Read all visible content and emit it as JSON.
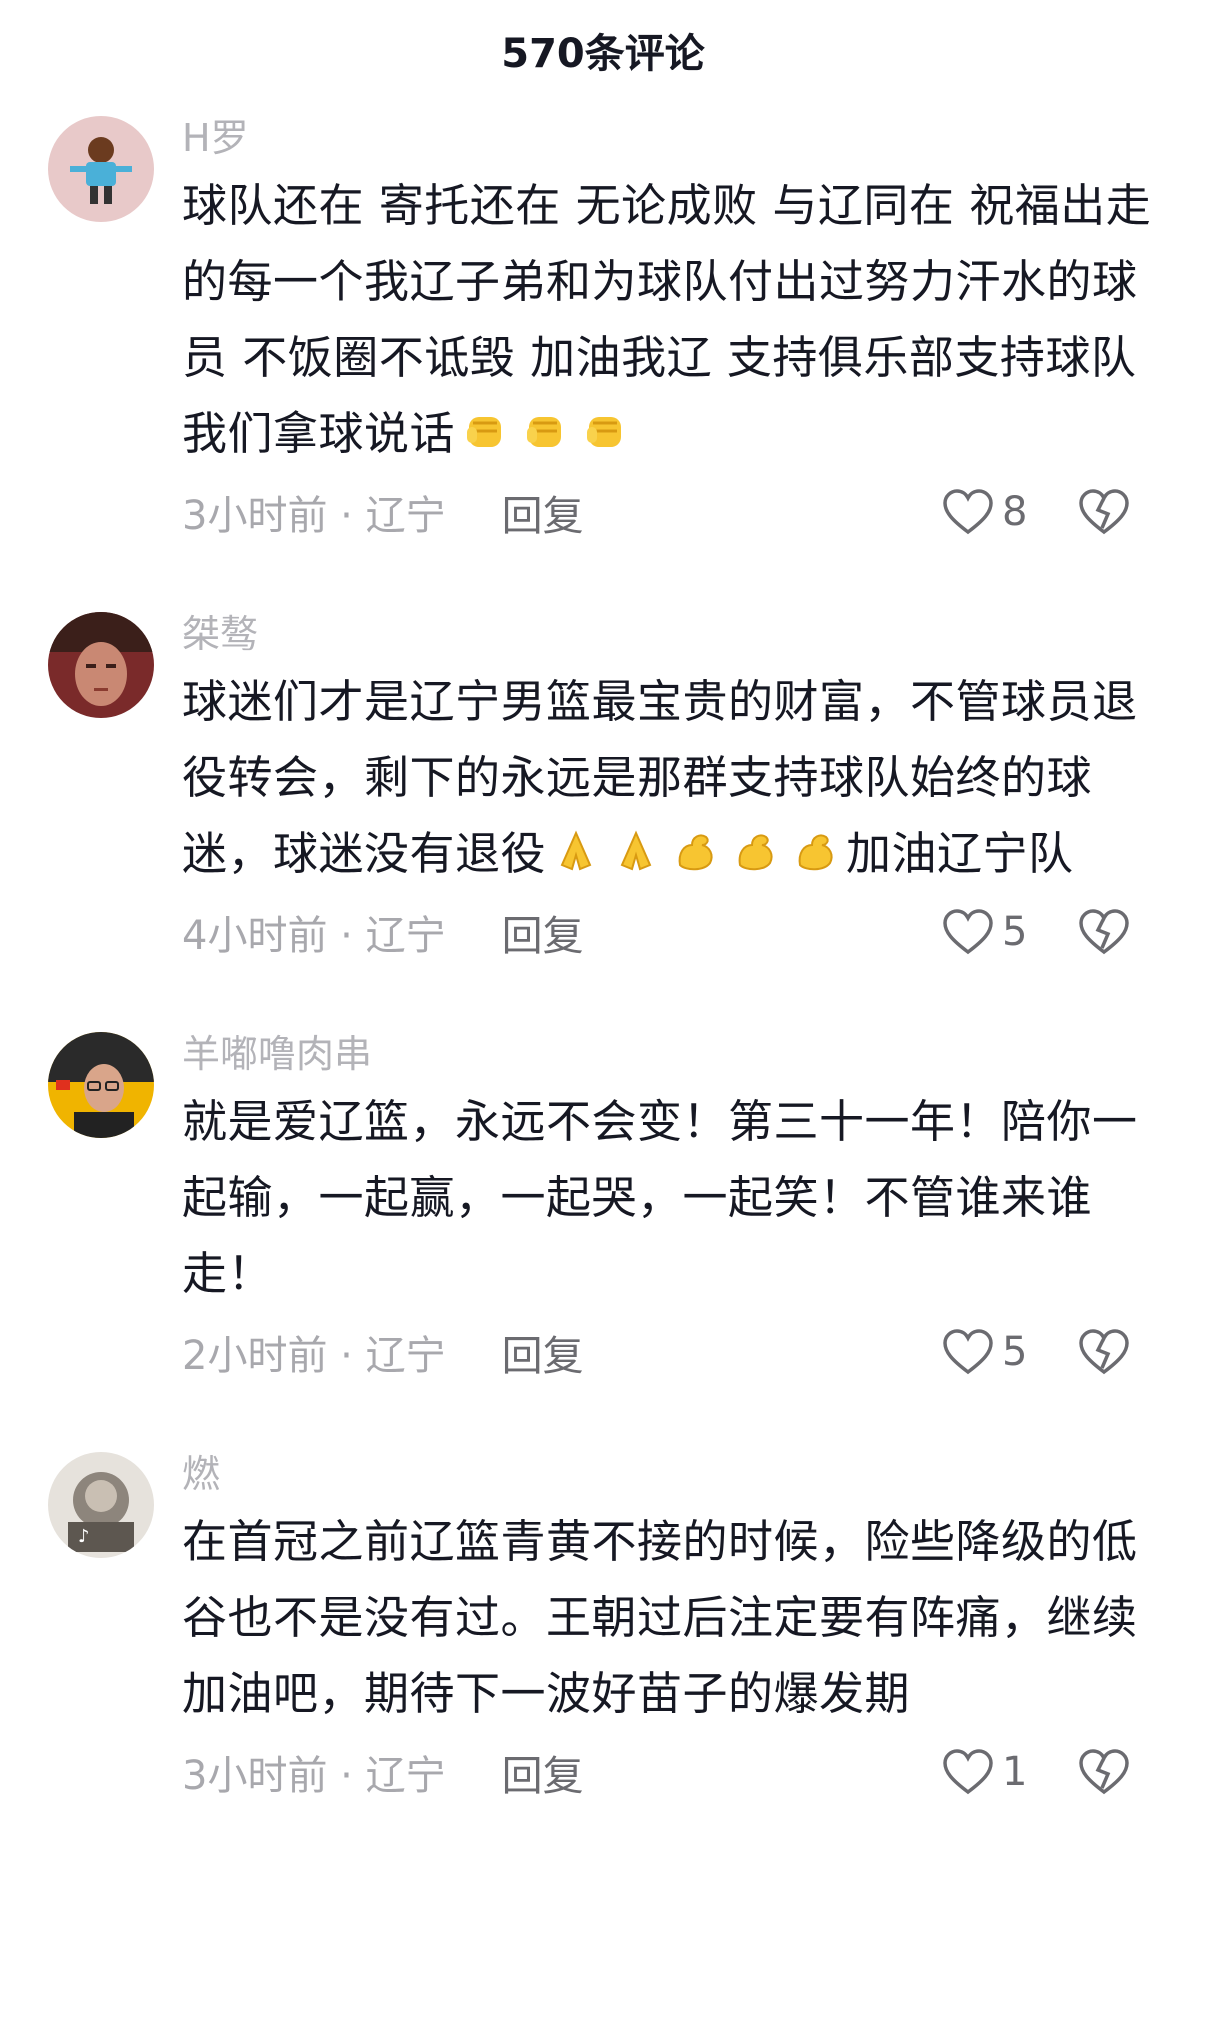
{
  "header": {
    "title": "570条评论"
  },
  "colors": {
    "username": "#b3b3b8",
    "text": "#161823",
    "meta": "#a8a8ad",
    "action": "#6b6b70"
  },
  "comments": [
    {
      "username": "H罗",
      "avatar_icon": "avatar-cartoon-boy-icon",
      "text_part1": "球队还在 寄托还在 无论成败 与辽同在 祝福出走的每一个我辽子弟和为球队付出过努力汗水的球员 不饭圈不诋毁 加油我辽 支持俱乐部支持球队我们拿球说话",
      "emojis": [
        "fist-emoji",
        "fist-emoji",
        "fist-emoji"
      ],
      "text_part2": "",
      "time_location": "3小时前 · 辽宁",
      "reply_label": "回复",
      "likes": "8"
    },
    {
      "username": "桀骜",
      "avatar_icon": "avatar-photo-face-icon",
      "text_part1": "球迷们才是辽宁男篮最宝贵的财富，不管球员退役转会，剩下的永远是那群支持球队始终的球迷，球迷没有退役",
      "emojis": [
        "pray-emoji",
        "pray-emoji",
        "muscle-emoji",
        "muscle-emoji",
        "muscle-emoji"
      ],
      "text_part2": "加油辽宁队",
      "time_location": "4小时前 · 辽宁",
      "reply_label": "回复",
      "likes": "5"
    },
    {
      "username": "羊嘟噜肉串",
      "avatar_icon": "avatar-photo-man-glasses-icon",
      "text_part1": "就是爱辽篮，永远不会变！第三十一年！陪你一起输，一起赢，一起哭，一起笑！不管谁来谁走！",
      "emojis": [],
      "text_part2": "",
      "time_location": "2小时前 · 辽宁",
      "reply_label": "回复",
      "likes": "5"
    },
    {
      "username": "燃",
      "avatar_icon": "avatar-photo-tiktok-icon",
      "text_part1": "在首冠之前辽篮青黄不接的时候，险些降级的低谷也不是没有过。王朝过后注定要有阵痛，继续加油吧，期待下一波好苗子的爆发期",
      "emojis": [],
      "text_part2": "",
      "time_location": "3小时前 · 辽宁",
      "reply_label": "回复",
      "likes": "1"
    }
  ]
}
